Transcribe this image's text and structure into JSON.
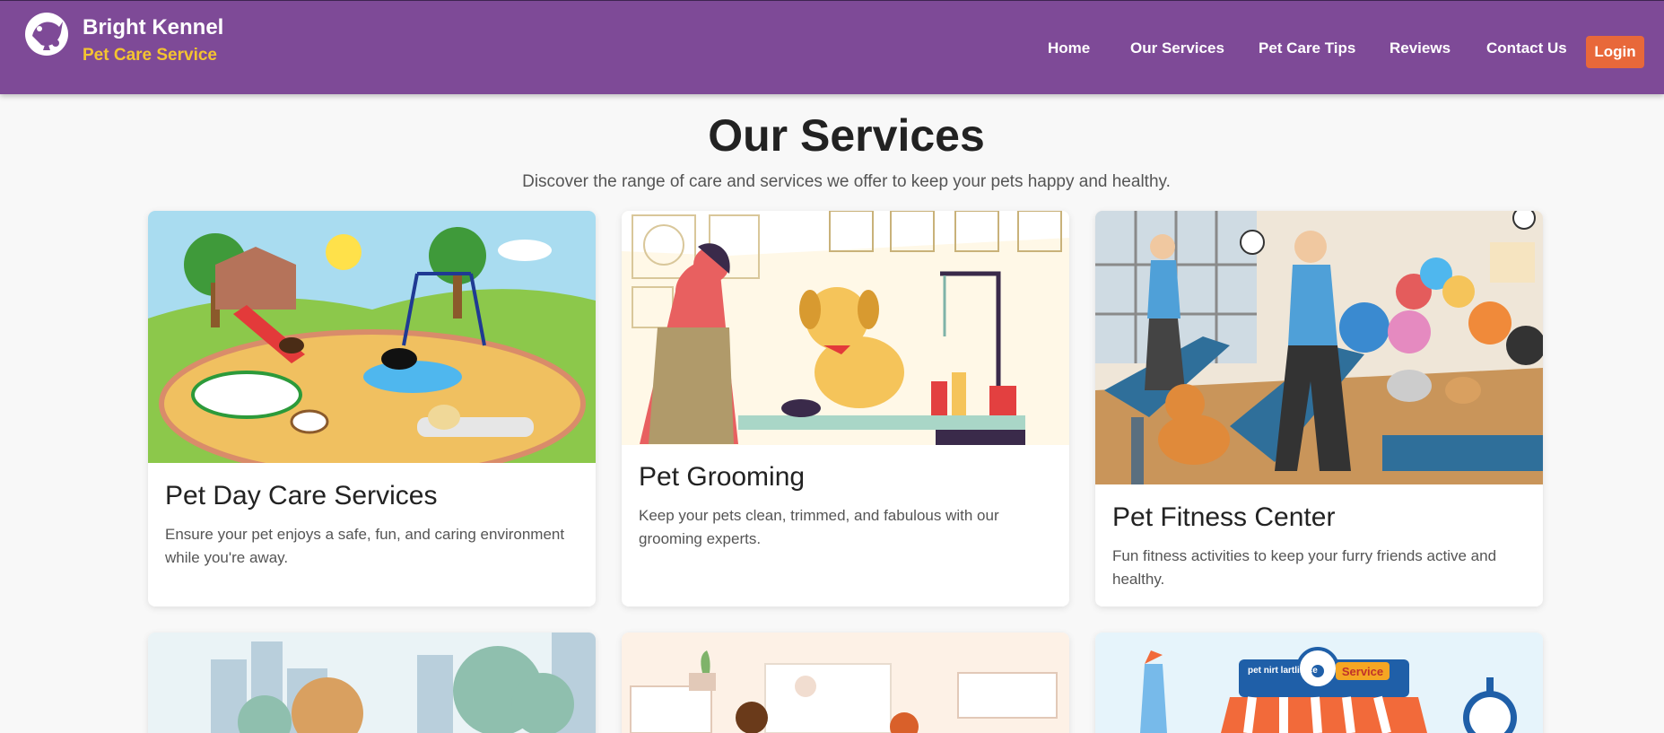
{
  "brand": {
    "name": "Bright Kennel",
    "tagline": "Pet Care Service",
    "logo_icon": "paw-dog-logo-icon"
  },
  "nav": {
    "items": [
      "Home",
      "Our Services",
      "Pet Care Tips",
      "Reviews",
      "Contact Us"
    ],
    "login_label": "Login"
  },
  "main": {
    "title": "Our Services",
    "subtitle": "Discover the range of care and services we offer to keep your pets happy and healthy."
  },
  "services": [
    {
      "title": "Pet Day Care Services",
      "description": "Ensure your pet enjoys a safe, fun, and caring environment while you're away.",
      "image_icon": "playground-illustration"
    },
    {
      "title": "Pet Grooming",
      "description": "Keep your pets clean, trimmed, and fabulous with our grooming experts.",
      "image_icon": "grooming-illustration"
    },
    {
      "title": "Pet Fitness Center",
      "description": "Fun fitness activities to keep your furry friends active and healthy.",
      "image_icon": "fitness-illustration"
    },
    {
      "image_icon": "park-illustration"
    },
    {
      "image_icon": "clinic-illustration"
    },
    {
      "image_icon": "pet-shop-illustration",
      "sign_text": "pet nirt lartlinice",
      "badge_text": "Service"
    }
  ],
  "colors": {
    "header": "#7e4a97",
    "accent": "#f4c430",
    "login": "#e8683a",
    "background": "#f8f8f8"
  }
}
